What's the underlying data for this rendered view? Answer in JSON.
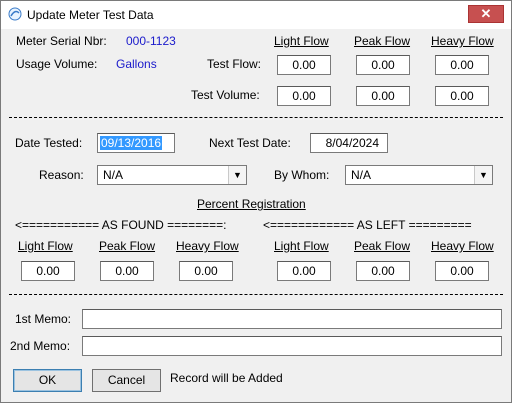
{
  "window": {
    "title": "Update Meter Test Data",
    "close_symbol": "✕"
  },
  "meter": {
    "serial_label": "Meter Serial Nbr:",
    "serial_value": "000-1123",
    "usage_label": "Usage Volume:",
    "usage_value": "Gallons"
  },
  "flow_headers": {
    "light": "Light Flow",
    "peak": "Peak Flow",
    "heavy": "Heavy Flow"
  },
  "test_flow": {
    "label": "Test Flow:",
    "light": "0.00",
    "peak": "0.00",
    "heavy": "0.00"
  },
  "test_volume": {
    "label": "Test Volume:",
    "light": "0.00",
    "peak": "0.00",
    "heavy": "0.00"
  },
  "dates": {
    "tested_label": "Date Tested:",
    "tested_value": "09/13/2016",
    "next_label": "Next Test Date:",
    "next_value": "8/04/2024"
  },
  "reason": {
    "label": "Reason:",
    "value": "N/A"
  },
  "by_whom": {
    "label": "By Whom:",
    "value": "N/A"
  },
  "percent_registration": {
    "title": "Percent Registration",
    "as_found_banner": "<=========== AS FOUND ========:",
    "as_left_banner": "<============ AS LEFT =========",
    "as_found": {
      "light_label": "Light Flow",
      "peak_label": "Peak Flow",
      "heavy_label": "Heavy Flow",
      "light": "0.00",
      "peak": "0.00",
      "heavy": "0.00"
    },
    "as_left": {
      "light_label": "Light Flow",
      "peak_label": "Peak Flow",
      "heavy_label": "Heavy Flow",
      "light": "0.00",
      "peak": "0.00",
      "heavy": "0.00"
    }
  },
  "memos": {
    "memo1_label": "1st Memo:",
    "memo1_value": "",
    "memo2_label": "2nd Memo:",
    "memo2_value": ""
  },
  "buttons": {
    "ok": "OK",
    "cancel": "Cancel"
  },
  "status": {
    "text": "Record will be Added"
  }
}
